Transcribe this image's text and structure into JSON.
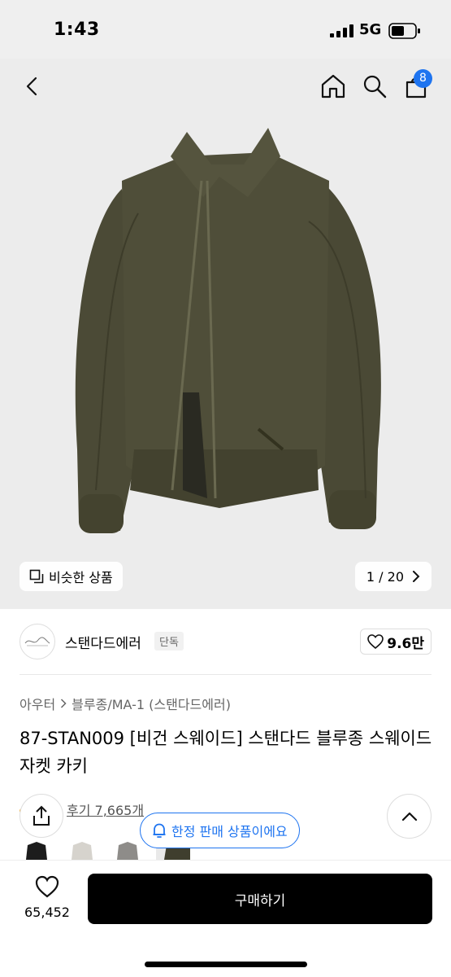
{
  "status_bar": {
    "time": "1:43",
    "network": "5G"
  },
  "header": {
    "cart_count": "8"
  },
  "gallery": {
    "similar_label": "비슷한 상품",
    "counter": "1 / 20"
  },
  "brand": {
    "name": "스탠다드에러",
    "tag": "단독",
    "likes": "9.6만"
  },
  "breadcrumb": [
    "아우터",
    "블루종/MA-1 (스탠다드에러)"
  ],
  "product": {
    "title": "87-STAN009 [비건 스웨이드] 스탠다드 블루종 스웨이드 자켓 카키",
    "review_link": "후기 7,665개"
  },
  "floating": {
    "limited_label": "한정 판매 상품이에요"
  },
  "bottom_bar": {
    "wishlist_count": "65,452",
    "buy_label": "구매하기"
  },
  "colors": {
    "accent": "#1e74f0",
    "jacket": "#4b4a36",
    "buy_button": "#000000"
  }
}
